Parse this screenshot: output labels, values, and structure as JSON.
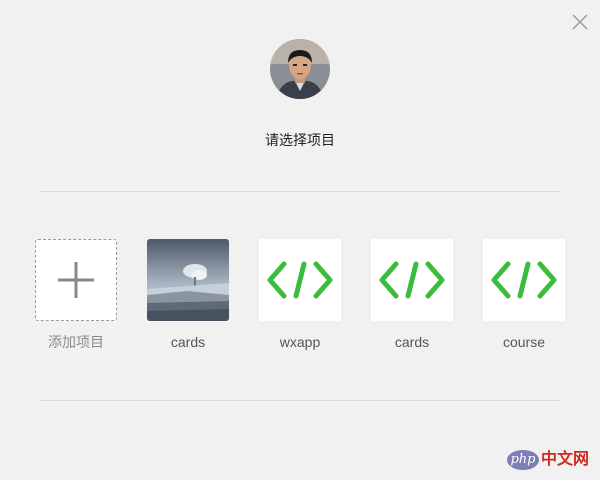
{
  "header": {
    "close_icon": "close-icon",
    "avatar_alt": "user-avatar",
    "prompt": "请选择项目"
  },
  "projects": [
    {
      "label": "添加项目",
      "kind": "add",
      "icon": "plus-icon"
    },
    {
      "label": "cards",
      "kind": "photo",
      "icon": "landscape-thumbnail"
    },
    {
      "label": "wxapp",
      "kind": "code",
      "icon": "code-brackets-icon"
    },
    {
      "label": "cards",
      "kind": "code",
      "icon": "code-brackets-icon"
    },
    {
      "label": "course",
      "kind": "code",
      "icon": "code-brackets-icon"
    }
  ],
  "watermark": {
    "logo_text": "php",
    "site_text": "中文网"
  },
  "colors": {
    "background": "#f1f1f1",
    "code_icon_green": "#3cbc3c",
    "plus_gray": "#888888",
    "divider": "#dcdcdc"
  }
}
